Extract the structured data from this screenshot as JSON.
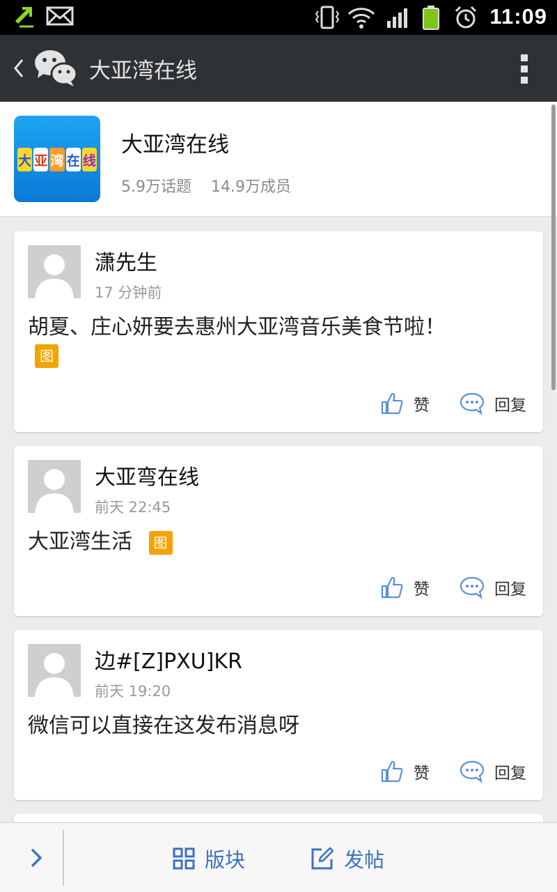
{
  "status_bar": {
    "time": "11:09"
  },
  "header": {
    "title": "大亚湾在线"
  },
  "group": {
    "name": "大亚湾在线",
    "logo_text": [
      "大",
      "亚",
      "湾",
      "在",
      "线"
    ],
    "topics": "5.9万话题",
    "members": "14.9万成员"
  },
  "posts": [
    {
      "author": "潇先生",
      "time": "17 分钟前",
      "content": "胡夏、庄心妍要去惠州大亚湾音乐美食节啦！",
      "badge": "图",
      "like_label": "赞",
      "reply_label": "回复"
    },
    {
      "author": "大亚弯在线",
      "time": "前天 22:45",
      "content": "大亚湾生活",
      "badge": "图",
      "like_label": "赞",
      "reply_label": "回复"
    },
    {
      "author": "边#[Z]PXU]KR",
      "time": "前天 19:20",
      "content": "微信可以直接在这发布消息呀",
      "like_label": "赞",
      "reply_label": "回复"
    }
  ],
  "bottom_bar": {
    "section_label": "版块",
    "post_label": "发帖"
  },
  "colors": {
    "accent": "#3a72c4",
    "badge": "#f5a300",
    "title_bar": "#2f3234"
  }
}
